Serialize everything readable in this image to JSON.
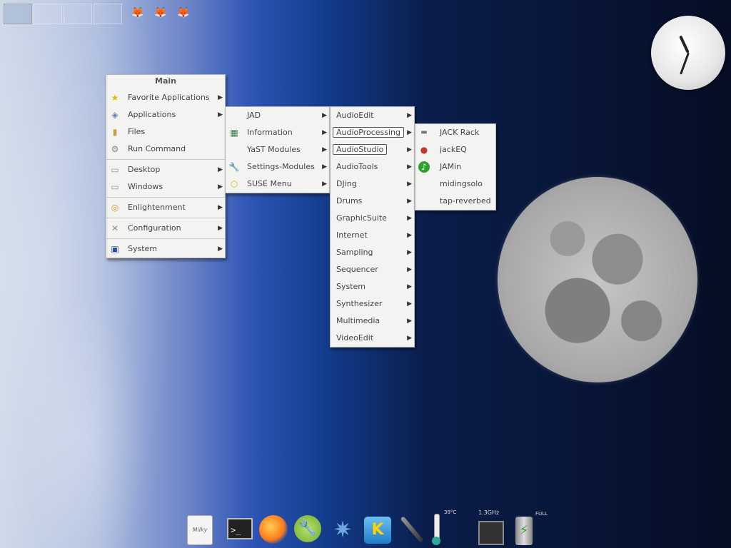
{
  "main_menu": {
    "title": "Main",
    "items": [
      {
        "label": "Favorite Applications",
        "icon": "star-icon",
        "submenu": true
      },
      {
        "label": "Applications",
        "icon": "applications-icon",
        "submenu": true
      },
      {
        "label": "Files",
        "icon": "folder-icon",
        "submenu": false
      },
      {
        "label": "Run Command",
        "icon": "run-command-icon",
        "submenu": false
      },
      {
        "label": "Desktop",
        "icon": "desktop-icon",
        "submenu": true
      },
      {
        "label": "Windows",
        "icon": "windows-icon",
        "submenu": true
      },
      {
        "label": "Enlightenment",
        "icon": "enlightenment-icon",
        "submenu": true
      },
      {
        "label": "Configuration",
        "icon": "configuration-icon",
        "submenu": true
      },
      {
        "label": "System",
        "icon": "system-icon",
        "submenu": true
      }
    ]
  },
  "applications_menu": {
    "items": [
      {
        "label": "JAD",
        "icon": "",
        "submenu": true
      },
      {
        "label": "Information",
        "icon": "information-icon",
        "submenu": true
      },
      {
        "label": "YaST Modules",
        "icon": "",
        "submenu": true
      },
      {
        "label": "Settings-Modules",
        "icon": "wrench-icon",
        "submenu": true
      },
      {
        "label": "SUSE Menu",
        "icon": "suse-menu-icon",
        "submenu": true
      }
    ]
  },
  "jad_menu": {
    "items": [
      {
        "label": "AudioEdit"
      },
      {
        "label": "AudioProcessing",
        "highlighted": true
      },
      {
        "label": "AudioStudio",
        "highlighted": true
      },
      {
        "label": "AudioTools"
      },
      {
        "label": "DJing"
      },
      {
        "label": "Drums"
      },
      {
        "label": "GraphicSuite"
      },
      {
        "label": "Internet"
      },
      {
        "label": "Sampling"
      },
      {
        "label": "Sequencer"
      },
      {
        "label": "System"
      },
      {
        "label": "Synthesizer"
      },
      {
        "label": "Multimedia"
      },
      {
        "label": "VideoEdit"
      }
    ]
  },
  "audiostudio_menu": {
    "items": [
      {
        "label": "JACK Rack",
        "icon": "jack-rack-icon"
      },
      {
        "label": "jackEQ",
        "icon": "jackeq-icon"
      },
      {
        "label": "JAMin",
        "icon": "jamin-icon"
      },
      {
        "label": "midingsolo",
        "icon": ""
      },
      {
        "label": "tap-reverbed",
        "icon": ""
      }
    ]
  },
  "dock": {
    "items": [
      "milky-icon",
      "terminal-icon",
      "firefox-icon",
      "yast-icon",
      "kde-network-icon",
      "kontact-icon",
      "audio-jack-icon",
      "thermometer-icon",
      "cpu-icon",
      "battery-icon"
    ],
    "temp_label": "39°C",
    "cpu_label": "1.3GHz",
    "battery_label": "FULL"
  }
}
